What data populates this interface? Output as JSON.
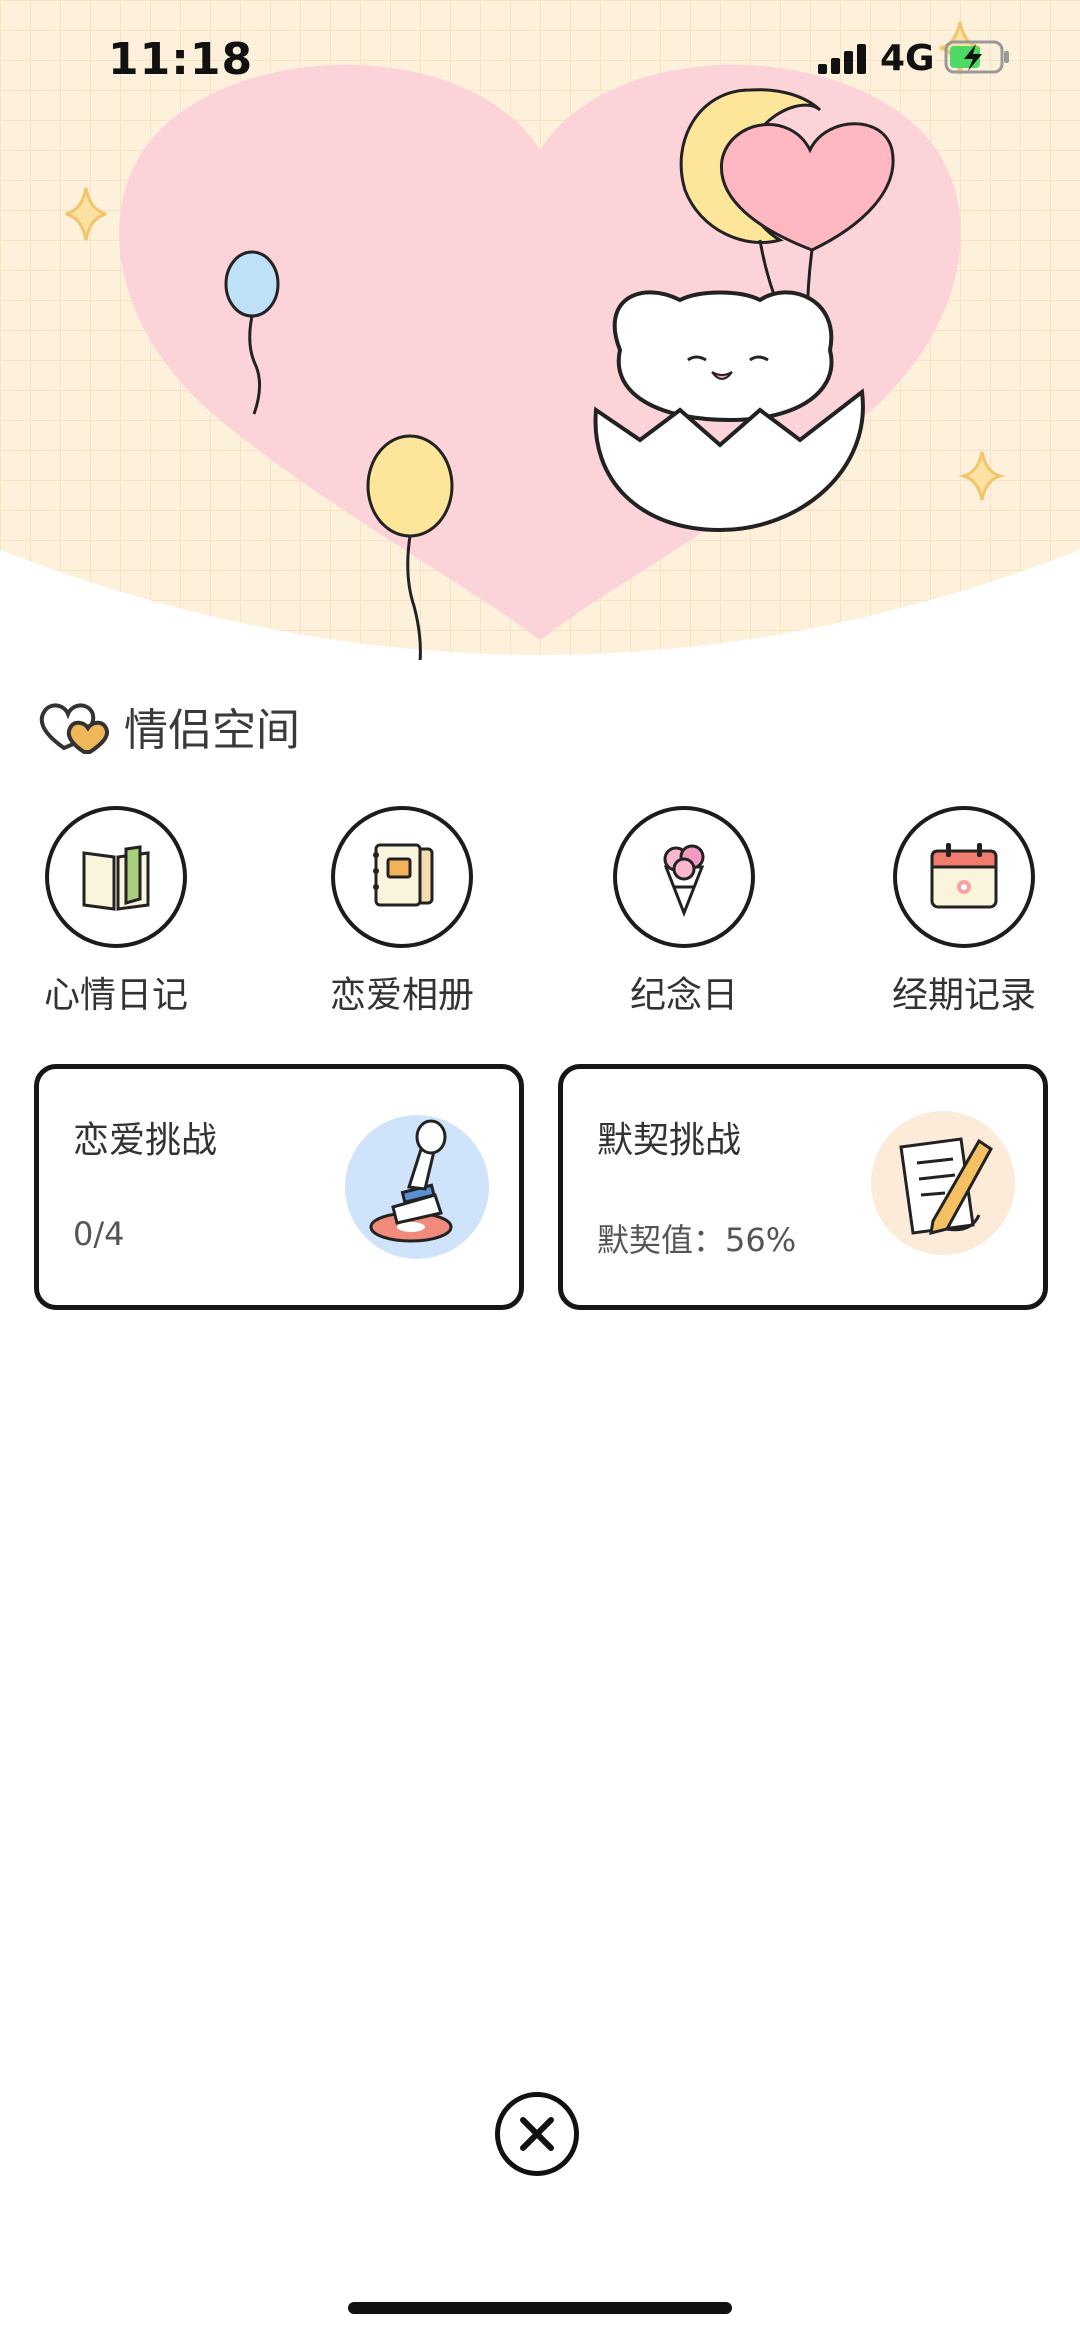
{
  "status_bar": {
    "time": "11:18",
    "network": "4G"
  },
  "section": {
    "title": "情侣空间"
  },
  "features": [
    {
      "label": "心情日记",
      "icon": "diary-book-icon"
    },
    {
      "label": "恋爱相册",
      "icon": "photo-album-icon"
    },
    {
      "label": "纪念日",
      "icon": "bouquet-icon"
    },
    {
      "label": "经期记录",
      "icon": "calendar-icon"
    }
  ],
  "cards": [
    {
      "title": "恋爱挑战",
      "value": "0/4",
      "icon": "stamp-icon"
    },
    {
      "title": "默契挑战",
      "value": "默契值：56%",
      "icon": "note-pencil-icon"
    }
  ],
  "colors": {
    "hero_bg": "#fdf1dc",
    "heart": "#fcd3d8",
    "balloon_blue": "#bfe1f7",
    "balloon_yellow": "#fde59a",
    "balloon_pink": "#ffb7c2"
  }
}
